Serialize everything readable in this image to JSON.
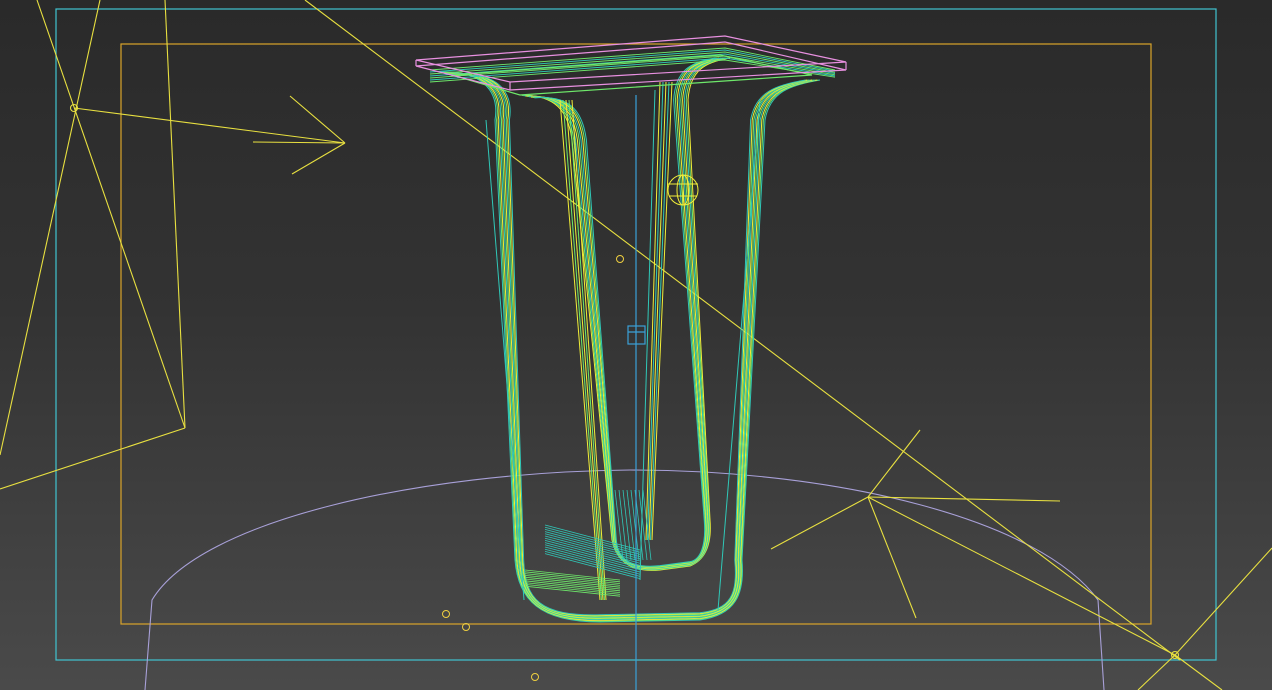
{
  "viewport": {
    "mode": "wireframe",
    "background_top": "#2a2a2a",
    "background_bottom": "#4a4a4a"
  },
  "colors": {
    "safe_frame_outer": "#40c4d0",
    "safe_frame_inner": "#d9a42a",
    "light_gizmo": "#e8e040",
    "model_green": "#6ee86a",
    "model_teal": "#30c8b8",
    "model_yellow": "#f2ee38",
    "selection_box": "#e890e0",
    "ground_ellipse": "#a8a0d8",
    "pivot_axis": "#3aa0d8",
    "camera_target": "#f0d040"
  },
  "objects": {
    "model": "chair-wireframe",
    "lights": [
      "omni-light-left",
      "spot-light-left",
      "spot-light-right",
      "sun-target-bottom-right"
    ],
    "helpers": [
      "safe-frame",
      "action-safe-frame",
      "ground-plane",
      "pivot-gizmo",
      "sphere-helper"
    ]
  }
}
